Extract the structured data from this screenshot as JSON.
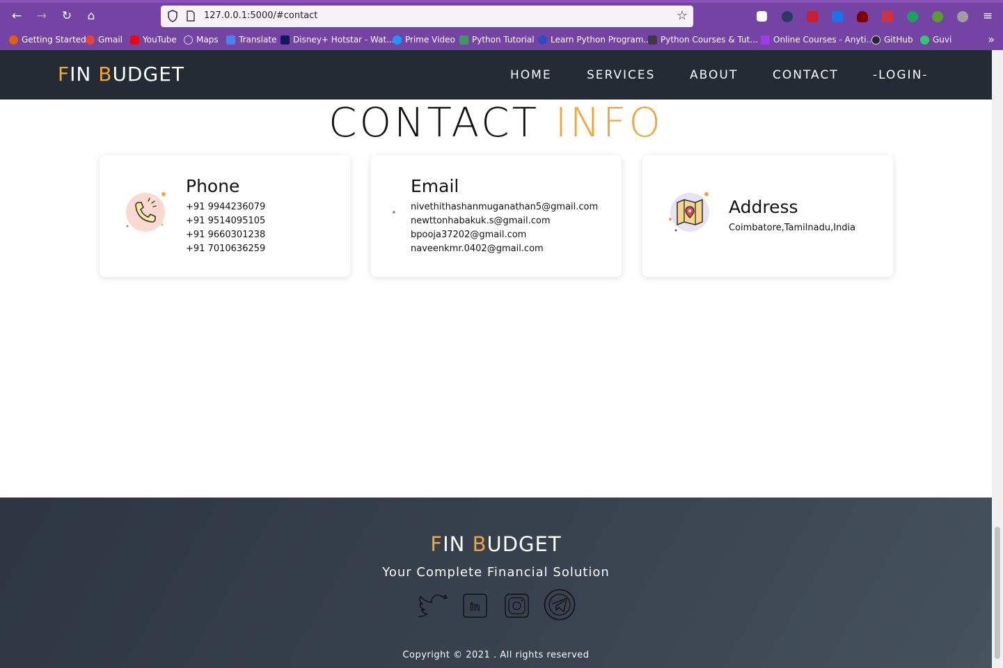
{
  "browser": {
    "url": "127.0.0.1:5000/#contact",
    "bookmarks": [
      {
        "label": "Getting Started",
        "color": "#e66000"
      },
      {
        "label": "Gmail",
        "color": "#ea4335"
      },
      {
        "label": "YouTube",
        "color": "#ff0000"
      },
      {
        "label": "Maps",
        "color": "#dddddd"
      },
      {
        "label": "Translate",
        "color": "#4285f4"
      },
      {
        "label": "Disney+ Hotstar - Wat...",
        "color": "#0c1e57"
      },
      {
        "label": "Prime Video",
        "color": "#1a98ff"
      },
      {
        "label": "Python Tutorial",
        "color": "#3c9a5f"
      },
      {
        "label": "Learn Python Program...",
        "color": "#2b4cc4"
      },
      {
        "label": "Python Courses & Tut...",
        "color": "#3c3c3c"
      },
      {
        "label": "Online Courses - Anyti...",
        "color": "#a435f0"
      },
      {
        "label": "GitHub",
        "color": "#24292e"
      },
      {
        "label": "Guvi",
        "color": "#2ecc71"
      }
    ]
  },
  "site": {
    "logo": {
      "f": "F",
      "in": "IN ",
      "b": "B",
      "udget": "UDGET"
    },
    "menu": [
      "HOME",
      "SERVICES",
      "ABOUT",
      "CONTACT",
      "-LOGIN-"
    ],
    "accent_color": "#f0a540"
  },
  "contact": {
    "title_main": "CONTACT",
    "title_accent": "INFO",
    "phone": {
      "heading": "Phone",
      "numbers": [
        "+91 9944236079",
        "+91 9514095105",
        "+91 9660301238",
        "+91 7010636259"
      ]
    },
    "email": {
      "heading": "Email",
      "addresses": [
        "nivethithashanmuganathan5@gmail.com",
        "newttonhabakuk.s@gmail.com",
        "bpooja37202@gmail.com",
        "naveenkmr.0402@gmail.com"
      ]
    },
    "address": {
      "heading": "Address",
      "text": "Coimbatore,Tamilnadu,India"
    }
  },
  "footer": {
    "tagline": "Your Complete Financial Solution",
    "copyright": "Copyright © 2021 . All rights reserved",
    "social_icons": [
      "twitter-icon",
      "linkedin-icon",
      "instagram-icon",
      "telegram-icon"
    ]
  }
}
